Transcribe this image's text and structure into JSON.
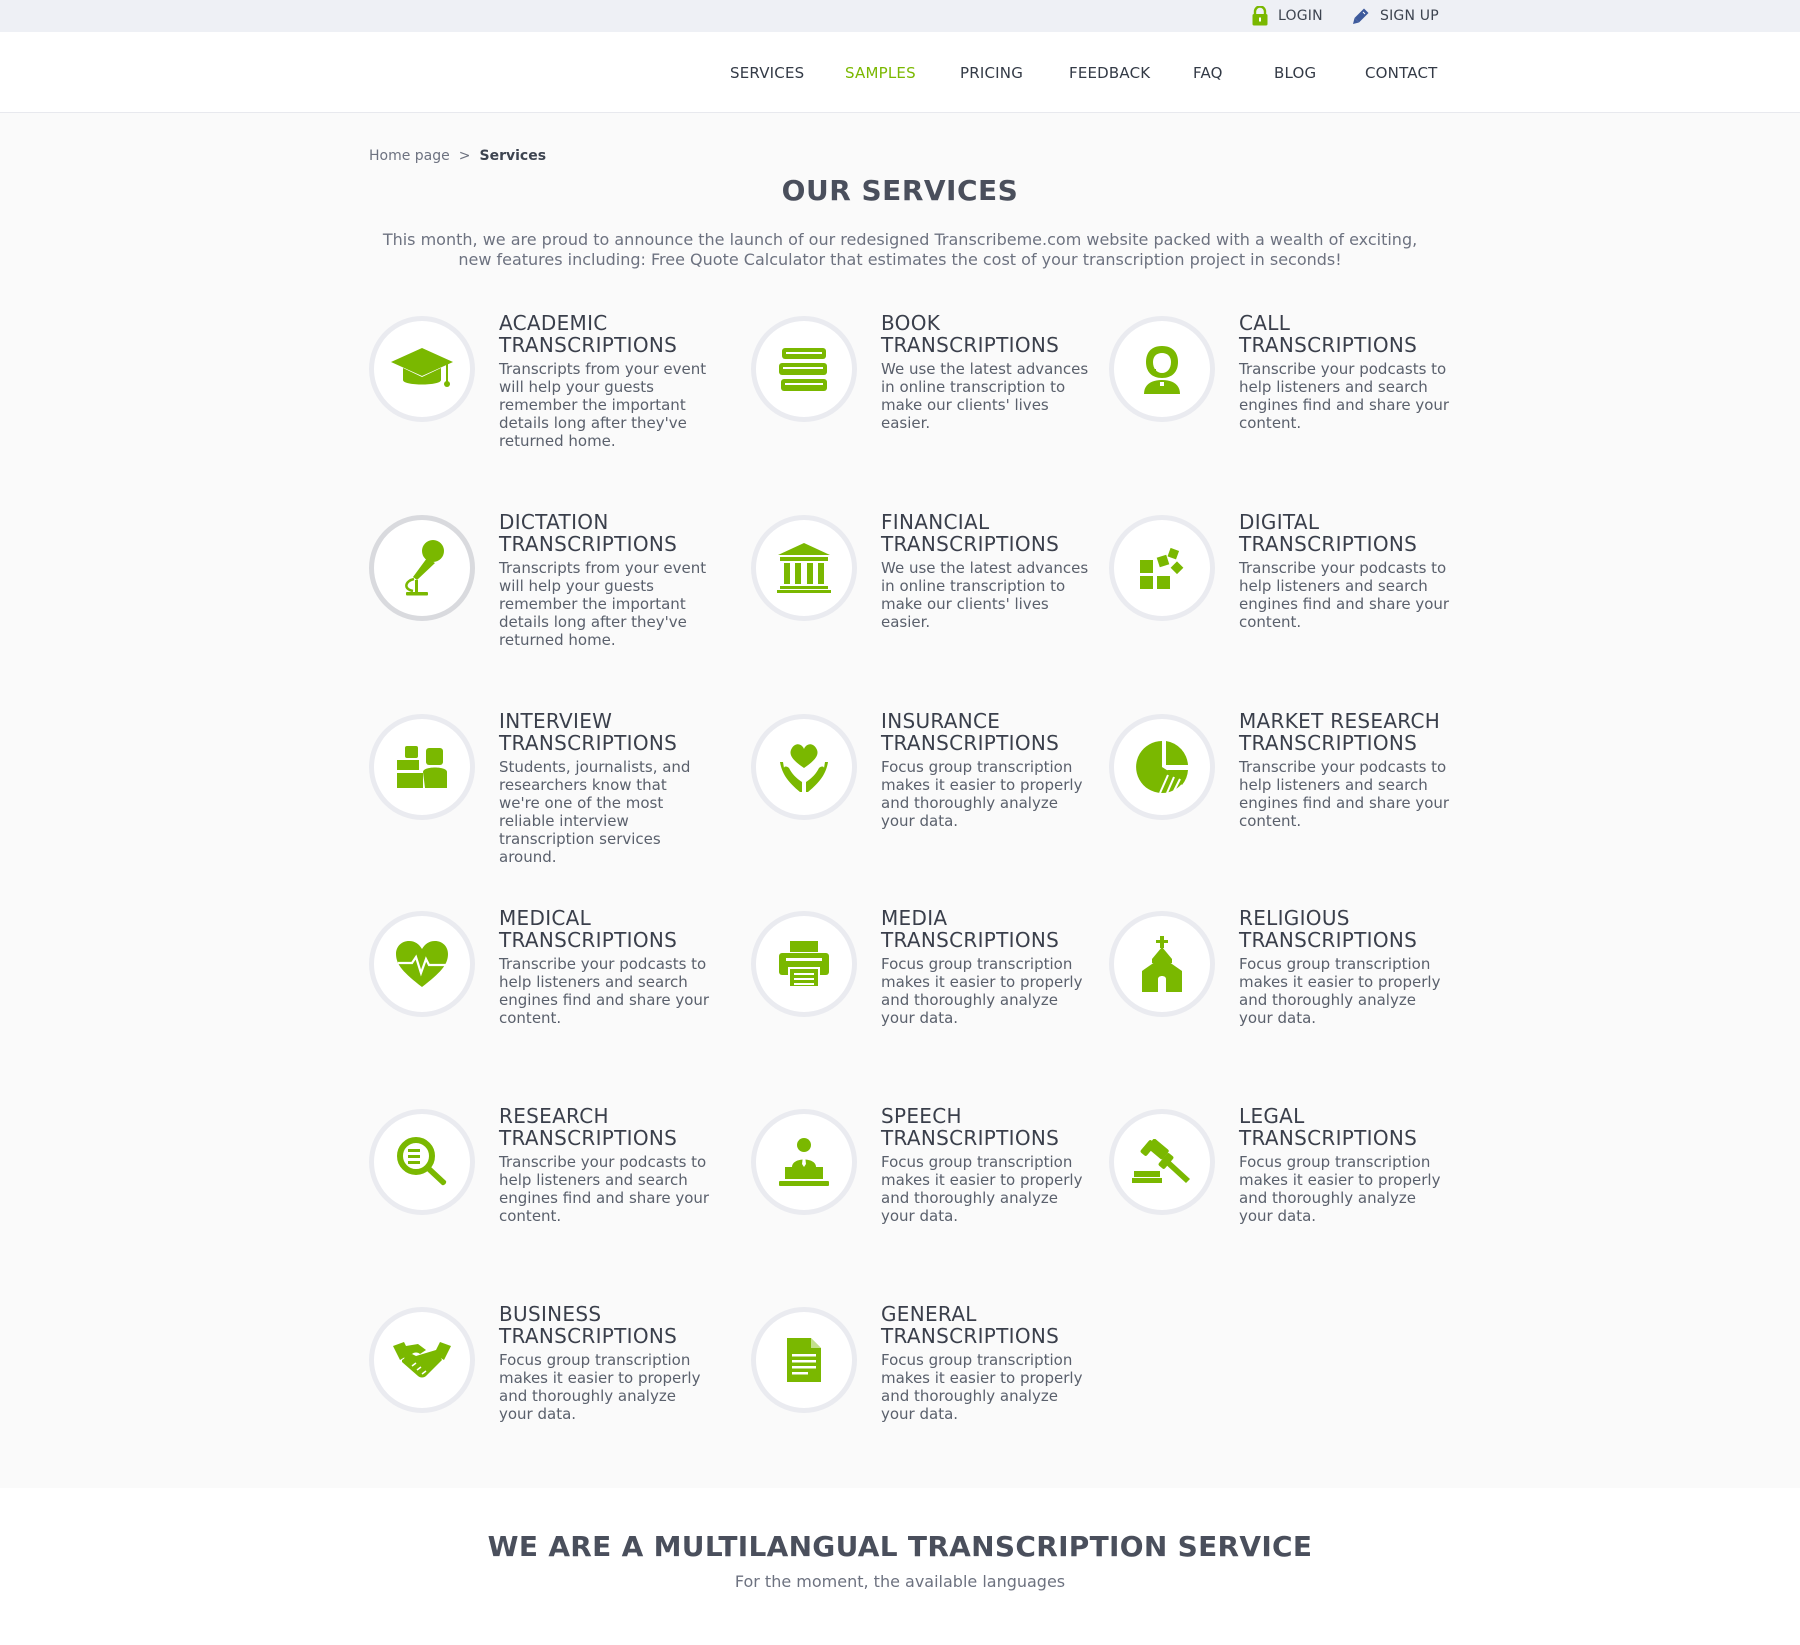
{
  "colors": {
    "accent": "#7ab800",
    "text_dark": "#3a3f4b",
    "topbar_bg": "#eef0f5"
  },
  "topbar": {
    "login": "LOGIN",
    "signup": "SIGN UP"
  },
  "nav": [
    "SERVICES",
    "SAMPLES",
    "PRICING",
    "FEEDBACK",
    "FAQ",
    "BLOG",
    "CONTACT"
  ],
  "nav_active": "SAMPLES",
  "breadcrumb": {
    "home": "Home page",
    "sep": ">",
    "current": "Services"
  },
  "page_title": "OUR SERVICES",
  "intro": "This month, we are proud to announce the launch of our redesigned Transcribeme.com website packed with a wealth of exciting, new features including: Free Quote Calculator that estimates the cost of your transcription project in seconds!",
  "services": [
    {
      "title_l1": "ACADEMIC",
      "title_l2": "TRANSCRIPTIONS",
      "icon": "graduation-cap-icon",
      "desc": "Transcripts from your event will help your guests remember the important details long after they've returned home."
    },
    {
      "title_l1": "BOOK",
      "title_l2": "TRANSCRIPTIONS",
      "icon": "books-icon",
      "desc": "We use the latest advances in online transcription to make our clients' lives easier."
    },
    {
      "title_l1": "CALL",
      "title_l2": "TRANSCRIPTIONS",
      "icon": "call-operator-icon",
      "desc": "Transcribe your podcasts to help listeners and search engines find and share your content."
    },
    {
      "title_l1": "DICTATION",
      "title_l2": "TRANSCRIPTIONS",
      "icon": "microphone-icon",
      "desc": "Transcripts from your event will help your guests remember the important details long after they've returned home."
    },
    {
      "title_l1": "FINANCIAL",
      "title_l2": "TRANSCRIPTIONS",
      "icon": "bank-icon",
      "desc": "We use the latest advances in online transcription to make our clients' lives easier."
    },
    {
      "title_l1": "DIGITAL",
      "title_l2": "TRANSCRIPTIONS",
      "icon": "digital-blocks-icon",
      "desc": "Transcribe your podcasts to help listeners and search engines find and share your content."
    },
    {
      "title_l1": "INTERVIEW",
      "title_l2": "TRANSCRIPTIONS",
      "icon": "interview-icon",
      "desc": "Students, journalists, and researchers know that we're one of the most reliable interview transcription services around."
    },
    {
      "title_l1": "INSURANCE",
      "title_l2": "TRANSCRIPTIONS",
      "icon": "heart-hands-icon",
      "desc": "Focus group transcription makes it easier to properly and thoroughly analyze your data."
    },
    {
      "title_l1": "MARKET RESEARCH",
      "title_l2": "TRANSCRIPTIONS",
      "icon": "pie-chart-icon",
      "desc": "Transcribe your podcasts to help listeners and search engines find and share your content."
    },
    {
      "title_l1": "MEDICAL",
      "title_l2": "TRANSCRIPTIONS",
      "icon": "heartbeat-icon",
      "desc": "Transcribe your podcasts to help listeners and search engines find and share your content."
    },
    {
      "title_l1": "MEDIA",
      "title_l2": "TRANSCRIPTIONS",
      "icon": "printer-icon",
      "desc": "Focus group transcription makes it easier to properly and thoroughly analyze your data."
    },
    {
      "title_l1": "RELIGIOUS",
      "title_l2": "TRANSCRIPTIONS",
      "icon": "church-icon",
      "desc": "Focus group transcription makes it easier to properly and thoroughly analyze your data."
    },
    {
      "title_l1": "RESEARCH",
      "title_l2": "TRANSCRIPTIONS",
      "icon": "magnifier-icon",
      "desc": "Transcribe your podcasts to help listeners and search engines find and share your content."
    },
    {
      "title_l1": "SPEECH",
      "title_l2": "TRANSCRIPTIONS",
      "icon": "podium-speaker-icon",
      "desc": "Focus group transcription makes it easier to properly and thoroughly analyze your data."
    },
    {
      "title_l1": "LEGAL",
      "title_l2": "TRANSCRIPTIONS",
      "icon": "gavel-icon",
      "desc": "Focus group transcription makes it easier to properly and thoroughly analyze your data."
    },
    {
      "title_l1": "BUSINESS",
      "title_l2": "TRANSCRIPTIONS",
      "icon": "handshake-icon",
      "desc": "Focus group transcription makes it easier to properly and thoroughly analyze your data."
    },
    {
      "title_l1": "GENERAL",
      "title_l2": "TRANSCRIPTIONS",
      "icon": "document-icon",
      "desc": "Focus group transcription makes it easier to properly and thoroughly analyze your data."
    }
  ],
  "multilingual": {
    "title": "WE ARE A MULTILANGUAL TRANSCRIPTION SERVICE",
    "subtitle": "For the moment, the available languages"
  }
}
